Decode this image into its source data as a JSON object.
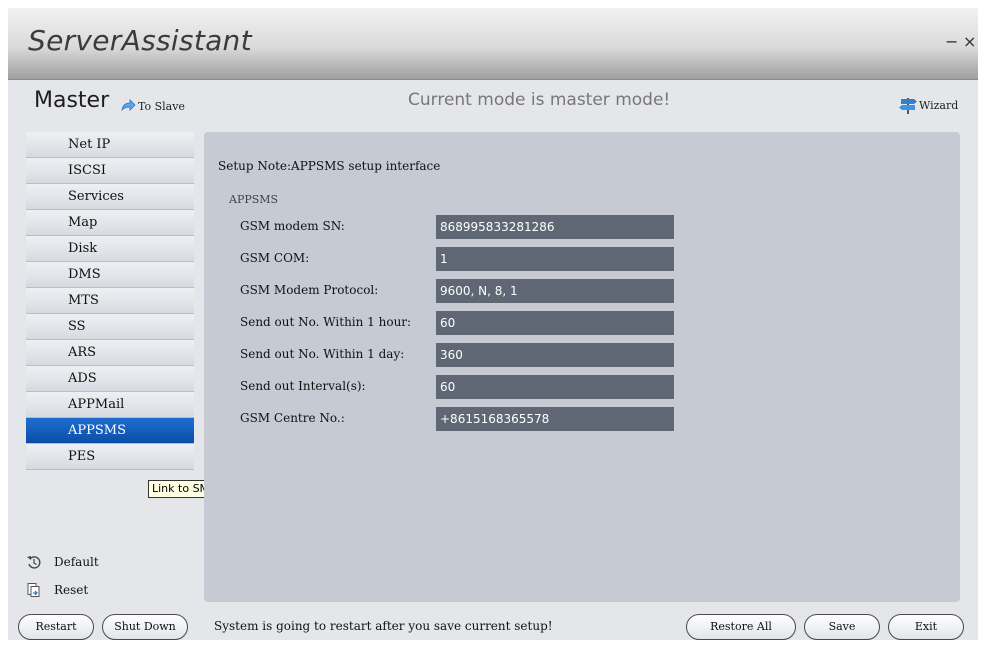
{
  "window": {
    "title": "ServerAssistant",
    "minimize_label": "−",
    "close_label": "×"
  },
  "header": {
    "mode_label": "Master",
    "to_slave_label": "To Slave",
    "mode_message": "Current mode is master mode!",
    "wizard_label": "Wizard"
  },
  "sidebar": {
    "items": [
      {
        "label": "Net IP"
      },
      {
        "label": "ISCSI"
      },
      {
        "label": "Services"
      },
      {
        "label": "Map"
      },
      {
        "label": "Disk"
      },
      {
        "label": "DMS"
      },
      {
        "label": "MTS"
      },
      {
        "label": "SS"
      },
      {
        "label": "ARS"
      },
      {
        "label": "ADS"
      },
      {
        "label": "APPMail"
      },
      {
        "label": "APPSMS"
      },
      {
        "label": "PES"
      }
    ],
    "active": "APPSMS",
    "tooltip": "Link to SMS",
    "default_label": "Default",
    "reset_label": "Reset"
  },
  "content": {
    "setup_note": "Setup Note:APPSMS setup interface",
    "section_title": "APPSMS",
    "fields": [
      {
        "label": "GSM modem SN:",
        "value": "868995833281286"
      },
      {
        "label": "GSM COM:",
        "value": "1"
      },
      {
        "label": "GSM Modem Protocol:",
        "value": "9600, N, 8, 1"
      },
      {
        "label": "Send out No. Within 1 hour:",
        "value": "60"
      },
      {
        "label": "Send out No. Within 1 day:",
        "value": "360"
      },
      {
        "label": "Send out Interval(s):",
        "value": "60"
      },
      {
        "label": "GSM Centre No.:",
        "value": "+8615168365578"
      }
    ]
  },
  "footer": {
    "restart_label": "Restart",
    "shutdown_label": "Shut Down",
    "message": "System is going to restart after you save current setup!",
    "restore_all_label": "Restore All",
    "save_label": "Save",
    "exit_label": "Exit"
  },
  "colors": {
    "active_item": "#0b4ea8",
    "input_bg": "#5f6774",
    "panel_bg": "#c5cad3"
  }
}
